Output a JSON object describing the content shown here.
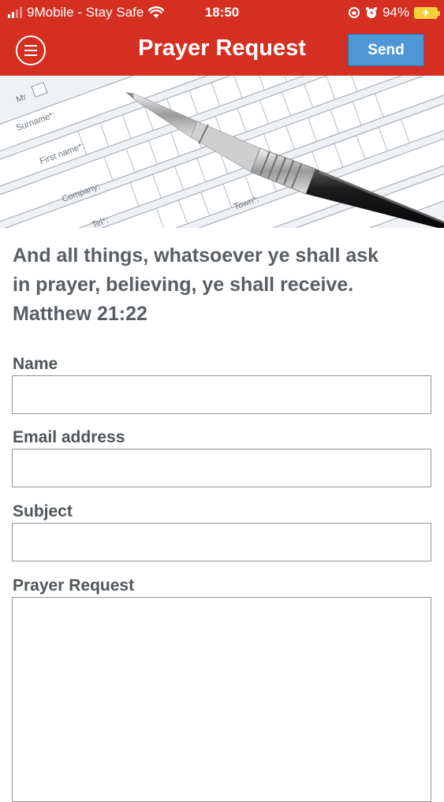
{
  "status_bar": {
    "carrier": "9Mobile - Stay Safe",
    "time": "18:50",
    "battery": "94%"
  },
  "header": {
    "title": "Prayer Request",
    "send_label": "Send"
  },
  "hero": {
    "form_labels": [
      "Mr",
      "Surname*:",
      "First name*:",
      "Company:",
      "Tel*:",
      "Town*:"
    ]
  },
  "verse": {
    "line1": "And all things, whatsoever ye shall ask",
    "line2": "in prayer, believing, ye shall receive.",
    "line3": "Matthew 21:22"
  },
  "form": {
    "name_label": "Name",
    "email_label": "Email address",
    "subject_label": "Subject",
    "request_label": "Prayer Request"
  },
  "colors": {
    "header_bg": "#d42f21",
    "send_button": "#4f96d5",
    "battery": "#f4d23a"
  }
}
